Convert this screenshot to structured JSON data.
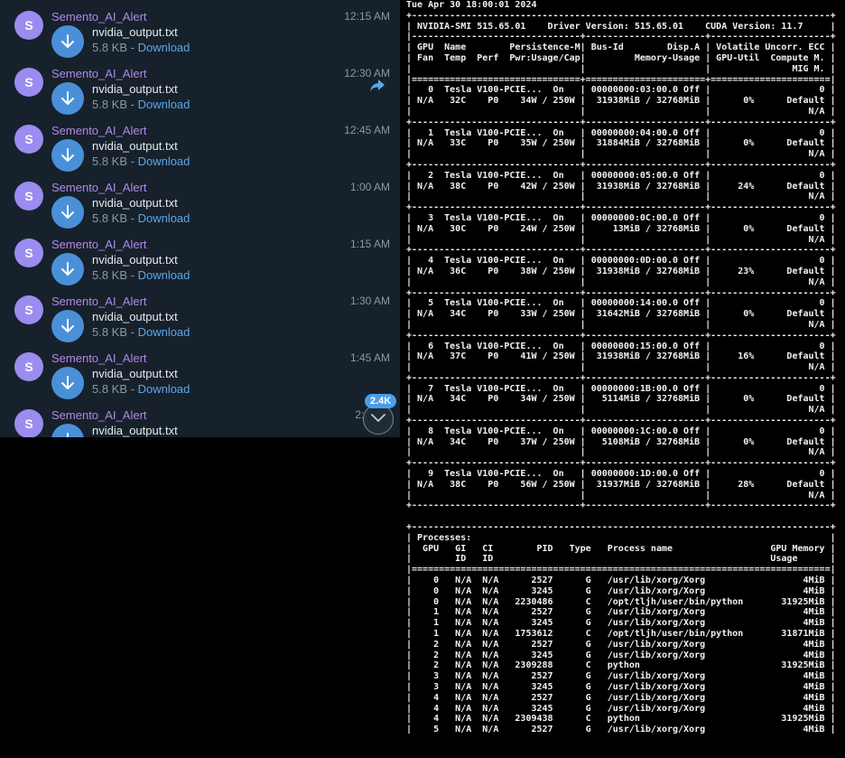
{
  "chat": {
    "badge": "2.4K",
    "messages": [
      {
        "sender": "Semento_AI_Alert",
        "avatar": "S",
        "time": "12:15 AM",
        "file": "nvidia_output.txt",
        "size": "5.8 KB - ",
        "download": "Download"
      },
      {
        "sender": "Semento_AI_Alert",
        "avatar": "S",
        "time": "12:30 AM",
        "file": "nvidia_output.txt",
        "size": "5.8 KB - ",
        "download": "Download"
      },
      {
        "sender": "Semento_AI_Alert",
        "avatar": "S",
        "time": "12:45 AM",
        "file": "nvidia_output.txt",
        "size": "5.8 KB - ",
        "download": "Download"
      },
      {
        "sender": "Semento_AI_Alert",
        "avatar": "S",
        "time": "1:00 AM",
        "file": "nvidia_output.txt",
        "size": "5.8 KB - ",
        "download": "Download"
      },
      {
        "sender": "Semento_AI_Alert",
        "avatar": "S",
        "time": "1:15 AM",
        "file": "nvidia_output.txt",
        "size": "5.8 KB - ",
        "download": "Download"
      },
      {
        "sender": "Semento_AI_Alert",
        "avatar": "S",
        "time": "1:30 AM",
        "file": "nvidia_output.txt",
        "size": "5.8 KB - ",
        "download": "Download"
      },
      {
        "sender": "Semento_AI_Alert",
        "avatar": "S",
        "time": "1:45 AM",
        "file": "nvidia_output.txt",
        "size": "5.8 KB - ",
        "download": "Download"
      },
      {
        "sender": "Semento_AI_Alert",
        "avatar": "S",
        "time": "2:0",
        "file": "nvidia_output.txt",
        "size": "",
        "download": ""
      }
    ]
  },
  "terminal": {
    "text": "Tue Apr 30 18:00:01 2024\n+-----------------------------------------------------------------------------+\n| NVIDIA-SMI 515.65.01    Driver Version: 515.65.01    CUDA Version: 11.7     |\n|-------------------------------+----------------------+----------------------+\n| GPU  Name        Persistence-M| Bus-Id        Disp.A | Volatile Uncorr. ECC |\n| Fan  Temp  Perf  Pwr:Usage/Cap|         Memory-Usage | GPU-Util  Compute M. |\n|                               |                      |               MIG M. |\n|===============================+======================+======================|\n|   0  Tesla V100-PCIE...  On   | 00000000:03:00.0 Off |                    0 |\n| N/A   32C    P0    34W / 250W |  31938MiB / 32768MiB |      0%      Default |\n|                               |                      |                  N/A |\n+-------------------------------+----------------------+----------------------+\n|   1  Tesla V100-PCIE...  On   | 00000000:04:00.0 Off |                    0 |\n| N/A   33C    P0    35W / 250W |  31884MiB / 32768MiB |      0%      Default |\n|                               |                      |                  N/A |\n+-------------------------------+----------------------+----------------------+\n|   2  Tesla V100-PCIE...  On   | 00000000:05:00.0 Off |                    0 |\n| N/A   38C    P0    42W / 250W |  31938MiB / 32768MiB |     24%      Default |\n|                               |                      |                  N/A |\n+-------------------------------+----------------------+----------------------+\n|   3  Tesla V100-PCIE...  On   | 00000000:0C:00.0 Off |                    0 |\n| N/A   30C    P0    24W / 250W |     13MiB / 32768MiB |      0%      Default |\n|                               |                      |                  N/A |\n+-------------------------------+----------------------+----------------------+\n|   4  Tesla V100-PCIE...  On   | 00000000:0D:00.0 Off |                    0 |\n| N/A   36C    P0    38W / 250W |  31938MiB / 32768MiB |     23%      Default |\n|                               |                      |                  N/A |\n+-------------------------------+----------------------+----------------------+\n|   5  Tesla V100-PCIE...  On   | 00000000:14:00.0 Off |                    0 |\n| N/A   34C    P0    33W / 250W |  31642MiB / 32768MiB |      0%      Default |\n|                               |                      |                  N/A |\n+-------------------------------+----------------------+----------------------+\n|   6  Tesla V100-PCIE...  On   | 00000000:15:00.0 Off |                    0 |\n| N/A   37C    P0    41W / 250W |  31938MiB / 32768MiB |     16%      Default |\n|                               |                      |                  N/A |\n+-------------------------------+----------------------+----------------------+\n|   7  Tesla V100-PCIE...  On   | 00000000:1B:00.0 Off |                    0 |\n| N/A   34C    P0    34W / 250W |   5114MiB / 32768MiB |      0%      Default |\n|                               |                      |                  N/A |\n+-------------------------------+----------------------+----------------------+\n|   8  Tesla V100-PCIE...  On   | 00000000:1C:00.0 Off |                    0 |\n| N/A   34C    P0    37W / 250W |   5108MiB / 32768MiB |      0%      Default |\n|                               |                      |                  N/A |\n+-------------------------------+----------------------+----------------------+\n|   9  Tesla V100-PCIE...  On   | 00000000:1D:00.0 Off |                    0 |\n| N/A   38C    P0    56W / 250W |  31937MiB / 32768MiB |     28%      Default |\n|                               |                      |                  N/A |\n+-------------------------------+----------------------+----------------------+\n\n+-----------------------------------------------------------------------------+\n| Processes:                                                                  |\n|  GPU   GI   CI        PID   Type   Process name                  GPU Memory |\n|        ID   ID                                                   Usage      |\n|=============================================================================|\n|    0   N/A  N/A      2527      G   /usr/lib/xorg/Xorg                  4MiB |\n|    0   N/A  N/A      3245      G   /usr/lib/xorg/Xorg                  4MiB |\n|    0   N/A  N/A   2230486      C   /opt/tljh/user/bin/python       31925MiB |\n|    1   N/A  N/A      2527      G   /usr/lib/xorg/Xorg                  4MiB |\n|    1   N/A  N/A      3245      G   /usr/lib/xorg/Xorg                  4MiB |\n|    1   N/A  N/A   1753612      C   /opt/tljh/user/bin/python       31871MiB |\n|    2   N/A  N/A      2527      G   /usr/lib/xorg/Xorg                  4MiB |\n|    2   N/A  N/A      3245      G   /usr/lib/xorg/Xorg                  4MiB |\n|    2   N/A  N/A   2309288      C   python                          31925MiB |\n|    3   N/A  N/A      2527      G   /usr/lib/xorg/Xorg                  4MiB |\n|    3   N/A  N/A      3245      G   /usr/lib/xorg/Xorg                  4MiB |\n|    4   N/A  N/A      2527      G   /usr/lib/xorg/Xorg                  4MiB |\n|    4   N/A  N/A      3245      G   /usr/lib/xorg/Xorg                  4MiB |\n|    4   N/A  N/A   2309438      C   python                          31925MiB |\n|    5   N/A  N/A      2527      G   /usr/lib/xorg/Xorg                  4MiB |"
  }
}
